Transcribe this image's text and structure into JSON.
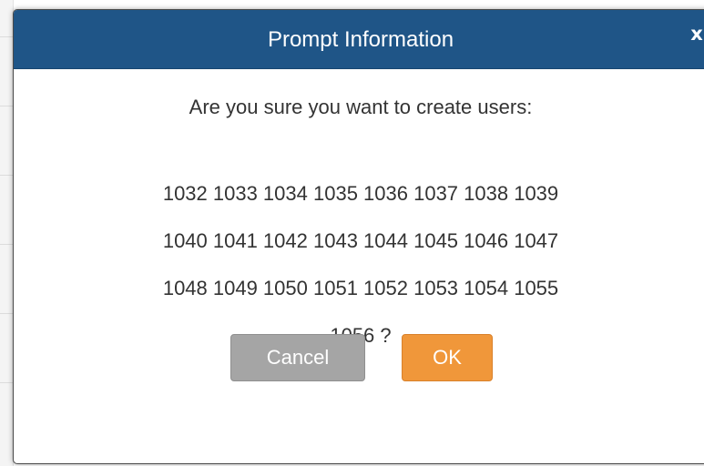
{
  "dialog": {
    "title": "Prompt Information",
    "close_label": "x",
    "question": "Are you sure you want to create users:",
    "user_lines": [
      "1032 1033 1034 1035 1036 1037 1038 1039",
      "1040 1041 1042 1043 1044 1045 1046 1047",
      "1048 1049 1050 1051 1052 1053 1054 1055",
      "1056 ?"
    ],
    "cancel_label": "Cancel",
    "ok_label": "OK"
  },
  "colors": {
    "titlebar": "#1f5587",
    "cancel_button": "#a5a5a5",
    "ok_button": "#f0973a",
    "text": "#333333"
  }
}
